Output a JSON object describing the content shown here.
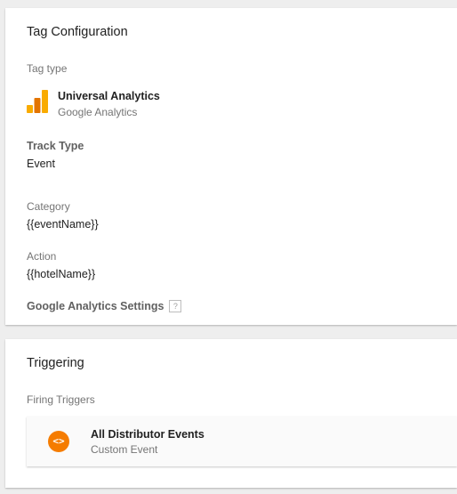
{
  "tag_configuration": {
    "title": "Tag Configuration",
    "tag_type_label": "Tag type",
    "tag_type": {
      "name": "Universal Analytics",
      "vendor": "Google Analytics",
      "icon": "google-analytics-icon",
      "colors": [
        "#f9ab00",
        "#e37400",
        "#f9ab00"
      ]
    },
    "track_type_label": "Track Type",
    "track_type_value": "Event",
    "category_label": "Category",
    "category_value": "{{eventName}}",
    "action_label": "Action",
    "action_value": "{{hotelName}}",
    "ga_settings_label": "Google Analytics Settings",
    "help_glyph": "?"
  },
  "triggering": {
    "title": "Triggering",
    "firing_triggers_label": "Firing Triggers",
    "triggers": [
      {
        "name": "All Distributor Events",
        "type": "Custom Event",
        "icon": "custom-event-icon",
        "icon_glyph": "<>",
        "icon_color": "#f57c00"
      }
    ]
  }
}
